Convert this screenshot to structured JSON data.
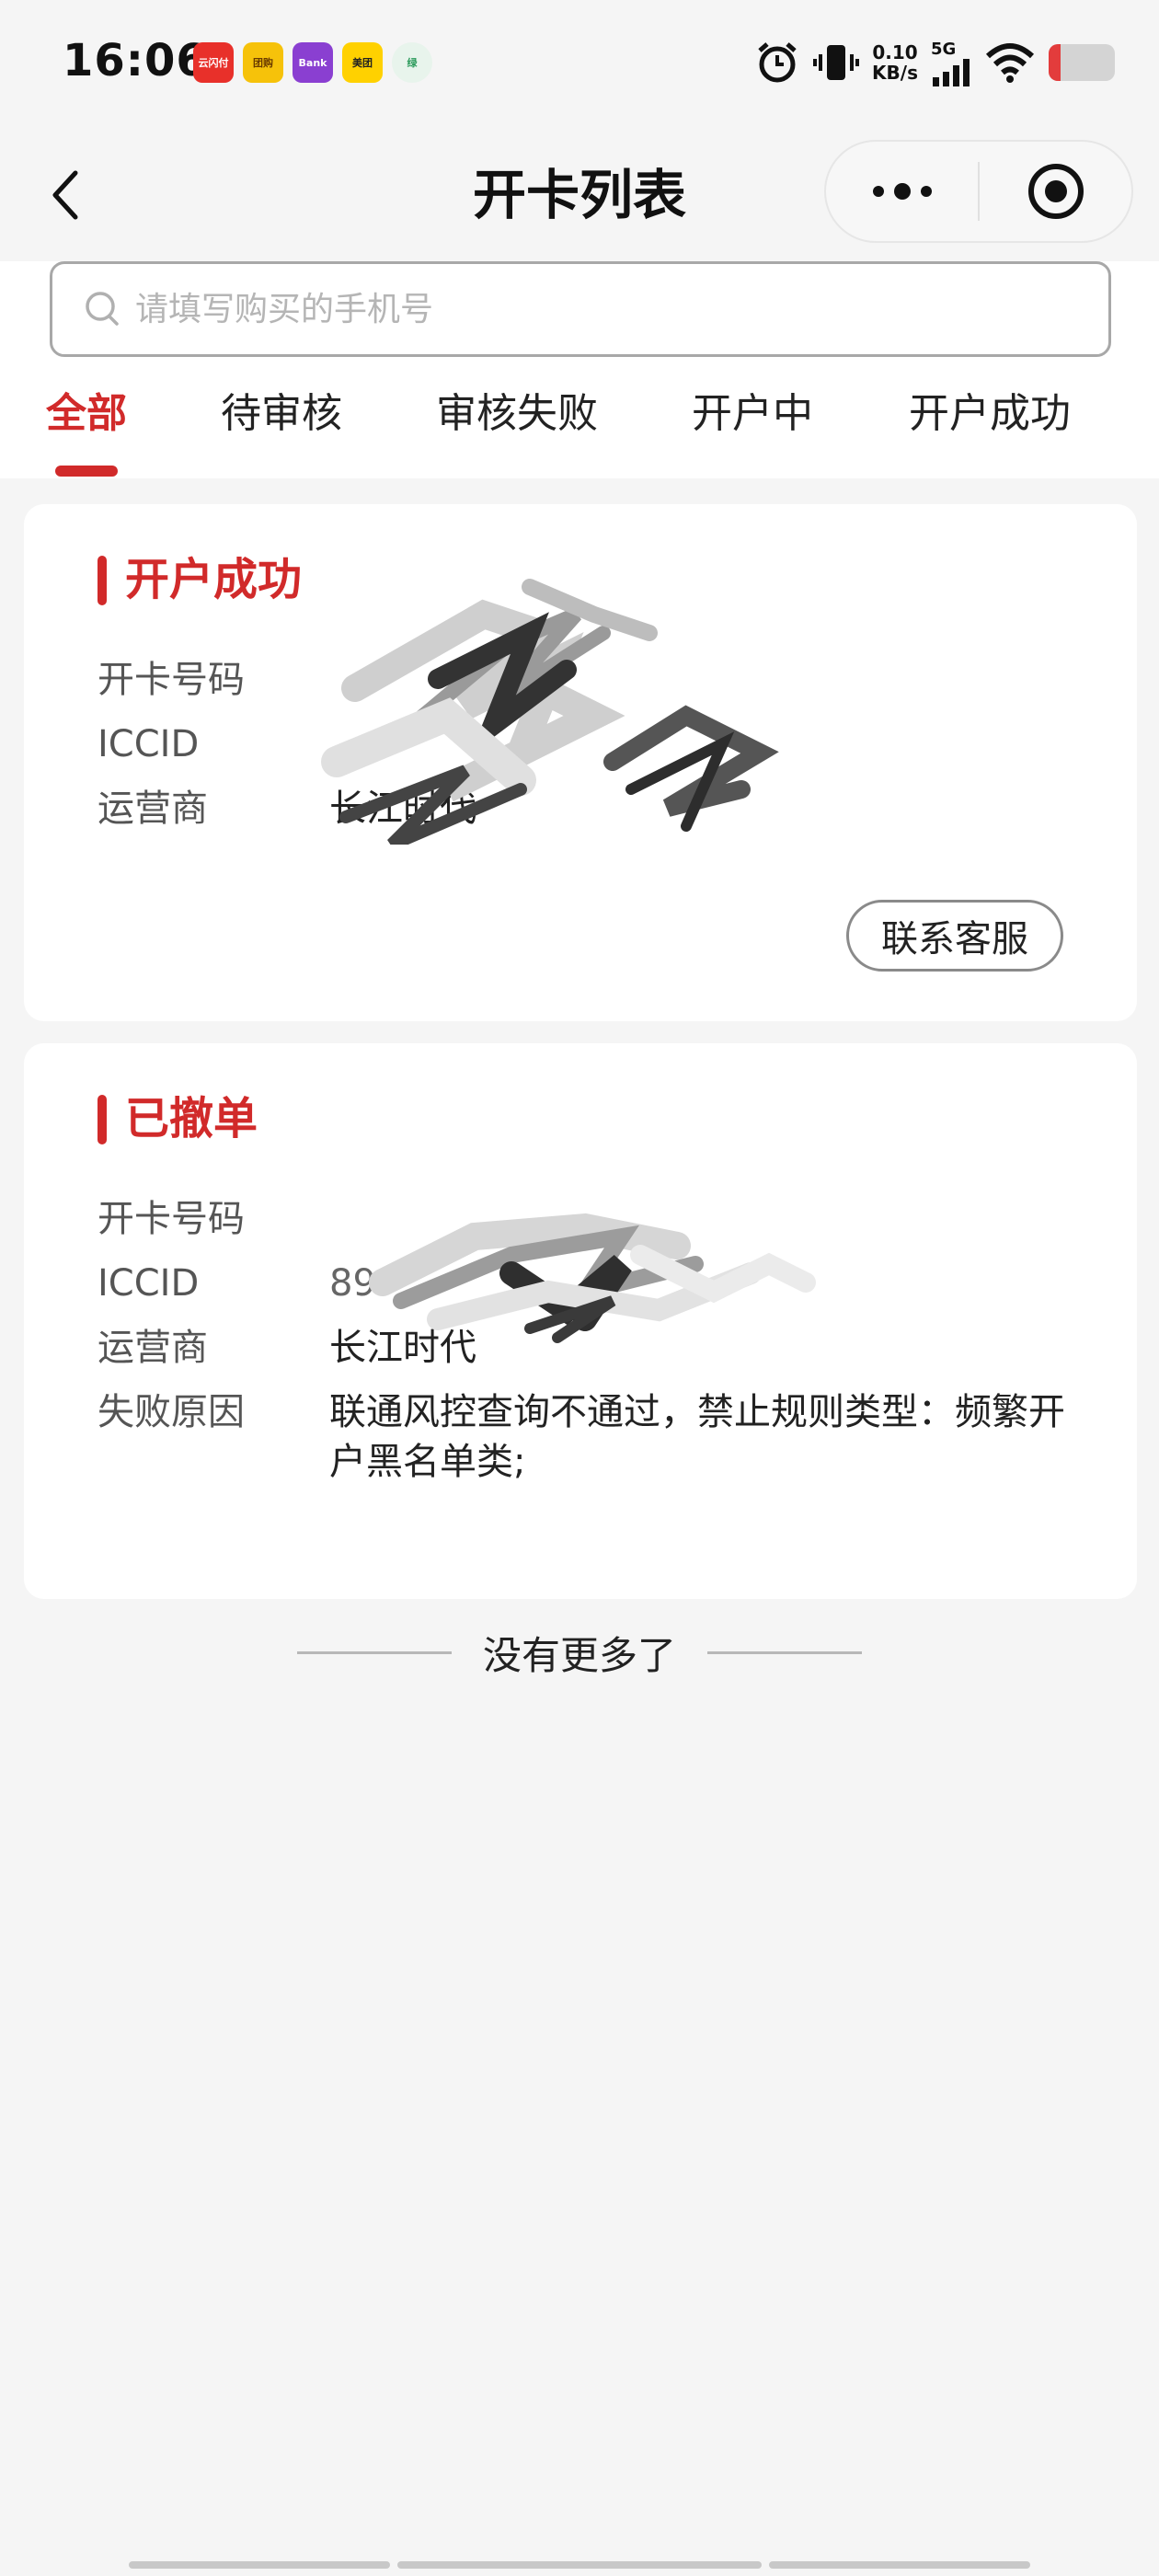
{
  "status_bar": {
    "time": "16:06",
    "apps": [
      {
        "label": "云闪付",
        "color": "#e8302a"
      },
      {
        "label": "团购",
        "color": "#f6c20a"
      },
      {
        "label": "Bank",
        "color": "#8a3fd1"
      },
      {
        "label": "美团",
        "color": "#ffd100"
      },
      {
        "label": "绿",
        "color": "#e8f4ec"
      }
    ],
    "net_speed_value": "0.10",
    "net_speed_unit": "KB/s",
    "signal_type": "5G",
    "battery_level": 0.18
  },
  "nav": {
    "title": "开卡列表"
  },
  "search": {
    "placeholder": "请填写购买的手机号",
    "value": ""
  },
  "tabs": [
    {
      "label": "全部",
      "active": true
    },
    {
      "label": "待审核",
      "active": false
    },
    {
      "label": "审核失败",
      "active": false
    },
    {
      "label": "开户中",
      "active": false
    },
    {
      "label": "开户成功",
      "active": false
    }
  ],
  "cards": [
    {
      "status": "开户成功",
      "rows": [
        {
          "label": "开卡号码",
          "value": ""
        },
        {
          "label": "ICCID",
          "value": ""
        },
        {
          "label": "运营商",
          "value": "长江时代"
        }
      ],
      "button": "联系客服"
    },
    {
      "status": "已撤单",
      "rows": [
        {
          "label": "开卡号码",
          "value": ""
        },
        {
          "label": "ICCID",
          "value": "89"
        },
        {
          "label": "运营商",
          "value": "长江时代"
        },
        {
          "label": "失败原因",
          "value": "联通风控查询不通过，禁止规则类型：频繁开户黑名单类;"
        }
      ]
    }
  ],
  "footer": {
    "end_text": "没有更多了"
  }
}
